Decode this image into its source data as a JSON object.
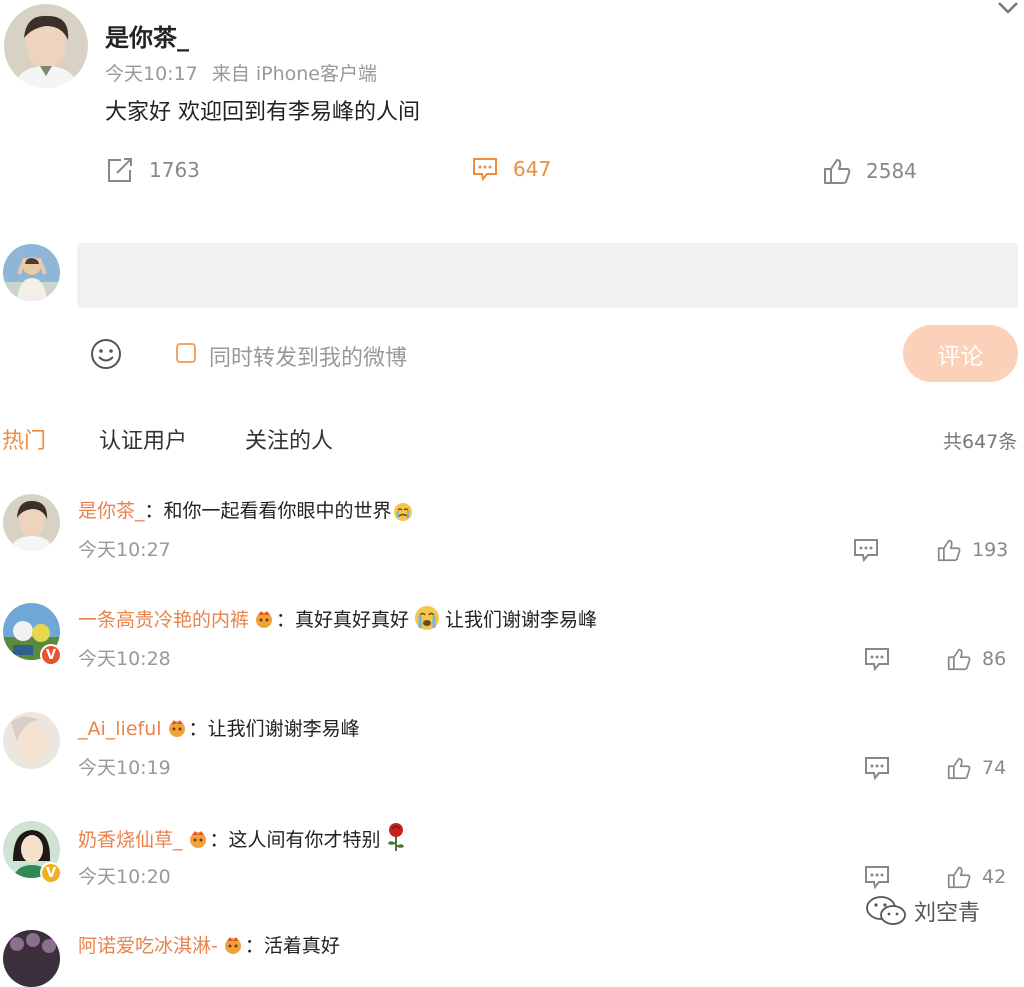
{
  "post": {
    "author": "是你茶_",
    "time": "今天10:17",
    "source": "来自 iPhone客户端",
    "text": "大家好 欢迎回到有李易峰的人间",
    "reposts": "1763",
    "comments": "647",
    "likes": "2584"
  },
  "composer": {
    "repost_label": "同时转发到我的微博",
    "submit_label": "评论"
  },
  "tabs": [
    "热门",
    "认证用户",
    "关注的人"
  ],
  "total": "共647条",
  "comments": [
    {
      "name": "是你茶_",
      "sep": "：",
      "text": "和你一起看看你眼中的世界",
      "time": "今天10:27",
      "likes": "193"
    },
    {
      "name": "一条高贵冷艳的内裤",
      "sep": "：",
      "text": "真好真好真好",
      "text2": "让我们谢谢李易峰",
      "time": "今天10:28",
      "likes": "86"
    },
    {
      "name": "_Ai_lieful",
      "sep": "：",
      "text": "让我们谢谢李易峰",
      "time": "今天10:19",
      "likes": "74"
    },
    {
      "name": "奶香烧仙草_",
      "sep": "：",
      "text": "这人间有你才特别",
      "time": "今天10:20",
      "likes": "42"
    },
    {
      "name": "阿诺爱吃冰淇淋-",
      "sep": "：",
      "text": "活着真好"
    }
  ],
  "watermark": "刘空青",
  "colors": {
    "accent": "#f08d3a",
    "name": "#e8834e",
    "button": "#fbd2b9"
  },
  "icons": [
    "share-icon",
    "comment-icon",
    "like-icon",
    "smiley-icon",
    "chevron-down-icon",
    "verified-icon",
    "vip-crown-icon",
    "rose-emoji",
    "crying-emoji",
    "wechat-icon"
  ]
}
